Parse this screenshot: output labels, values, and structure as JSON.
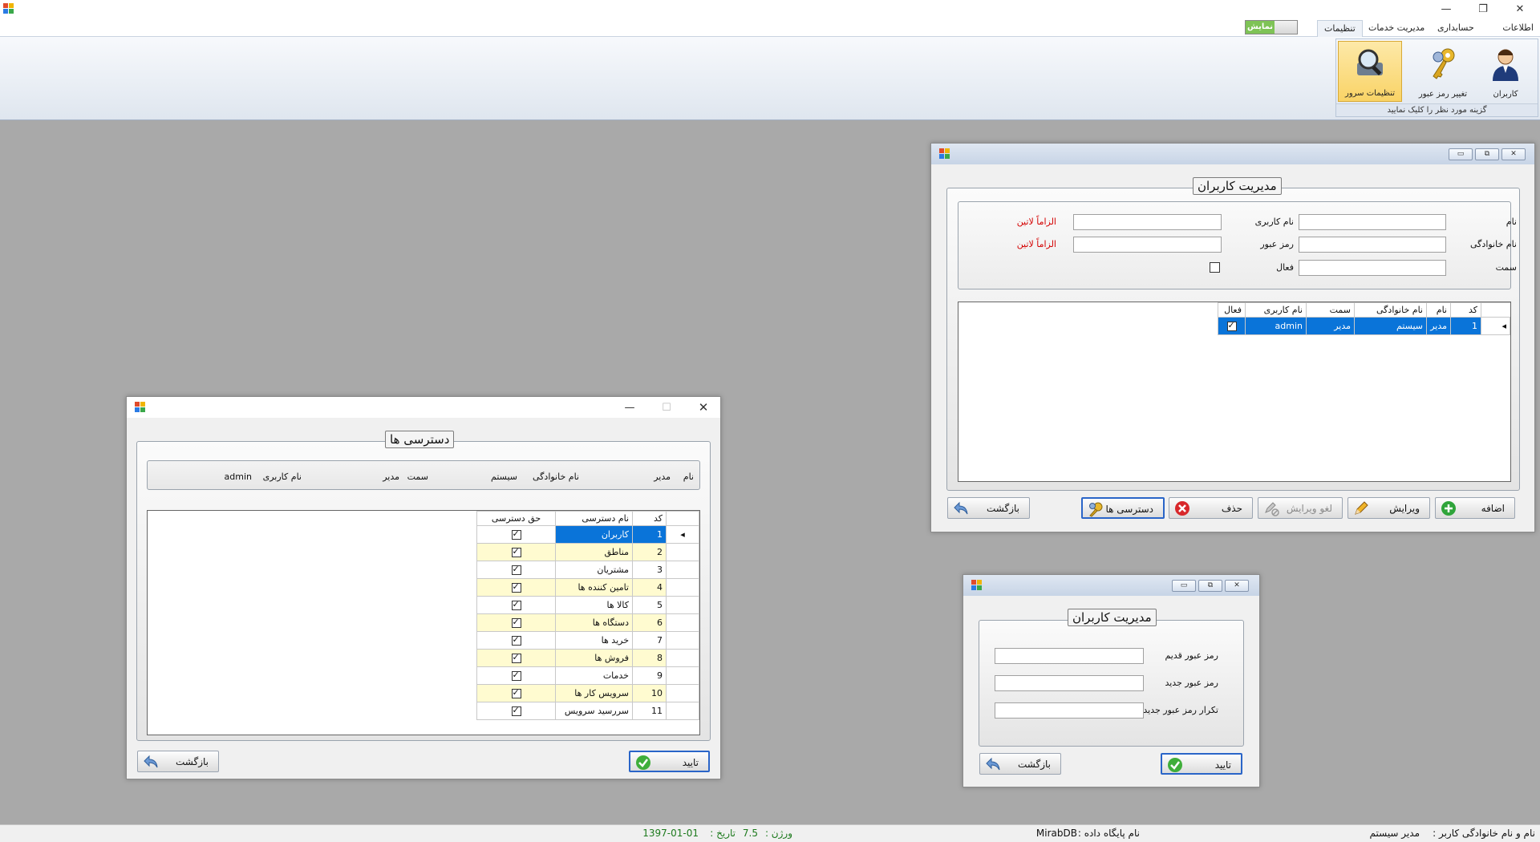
{
  "ribbon": {
    "tabs": [
      "اطلاعات پایه",
      "حسابداری",
      "مدیریت خدمات",
      "تنظیمات"
    ],
    "active_tab": "تنظیمات",
    "display_toggle": "نمایش",
    "buttons": [
      "کاربران",
      "تغییر رمز عبور",
      "تنظیمات سرور"
    ],
    "group_caption": "گزینه مورد نظر را کلیک نمایید"
  },
  "users_window": {
    "title": "مدیریت کاربران",
    "labels": {
      "name": "نام",
      "family": "نام خانوادگی",
      "position": "سمت",
      "username": "نام کاربری",
      "password": "رمز عبور",
      "active": "فعال",
      "latin_required_1": "الزاماً لاتین",
      "latin_required_2": "الزاماً لاتین"
    },
    "fields": {
      "name": "",
      "family": "",
      "position": "",
      "username": "",
      "password": ""
    },
    "grid_headers": [
      "کد",
      "نام",
      "نام خانوادگی",
      "سمت",
      "نام کاربری",
      "فعال"
    ],
    "grid_rows": [
      {
        "code": "1",
        "name": "مدیر",
        "family": "سیستم",
        "position": "مدیر",
        "username": "admin",
        "active": true
      }
    ],
    "buttons": {
      "add": "اضافه",
      "edit": "ویرایش",
      "cancel_edit": "لغو ویرایش",
      "delete": "حذف",
      "permissions": "دسترسی ها",
      "back": "بازگشت"
    }
  },
  "access_window": {
    "title": "دسترسی ها",
    "info": {
      "name_label": "نام",
      "name_value": "مدیر",
      "family_label": "نام خانوادگی",
      "family_value": "سیستم",
      "position_label": "سمت",
      "position_value": "مدیر",
      "username_label": "نام کاربری",
      "username_value": "admin"
    },
    "grid_headers": [
      "کد",
      "نام دسترسی",
      "حق دسترسی"
    ],
    "grid_rows": [
      {
        "code": "1",
        "name": "کاربران",
        "granted": true
      },
      {
        "code": "2",
        "name": "مناطق",
        "granted": true
      },
      {
        "code": "3",
        "name": "مشتریان",
        "granted": true
      },
      {
        "code": "4",
        "name": "تامین کننده ها",
        "granted": true
      },
      {
        "code": "5",
        "name": "کالا ها",
        "granted": true
      },
      {
        "code": "6",
        "name": "دستگاه ها",
        "granted": true
      },
      {
        "code": "7",
        "name": "خرید ها",
        "granted": true
      },
      {
        "code": "8",
        "name": "فروش ها",
        "granted": true
      },
      {
        "code": "9",
        "name": "خدمات",
        "granted": true
      },
      {
        "code": "10",
        "name": "سرویس کار ها",
        "granted": true
      },
      {
        "code": "11",
        "name": "سررسید سرویس",
        "granted": true
      }
    ],
    "buttons": {
      "ok": "تایید",
      "back": "بازگشت"
    }
  },
  "password_window": {
    "title": "مدیریت کاربران",
    "labels": {
      "old": "رمز عبور قدیم",
      "new": "رمز عبور جدید",
      "repeat": "تکرار رمز عبور جدید"
    },
    "fields": {
      "old": "",
      "new": "",
      "repeat": ""
    },
    "buttons": {
      "ok": "تایید",
      "back": "بازگشت"
    }
  },
  "status": {
    "user_label": "نام و نام خانوادگی کاربر :",
    "user_value": "مدیر سیستم",
    "db_label": "نام پایگاه داده :",
    "db_value": "MirabDB",
    "version_label": "ورژن :",
    "version_value": "7.5",
    "date_label": "تاریخ :",
    "date_value": "1397-01-01"
  },
  "colors": {
    "selection": "#0a74d9",
    "alt_row": "#fffbd0",
    "desktop": "#a9a9a9",
    "required": "#d40000"
  }
}
